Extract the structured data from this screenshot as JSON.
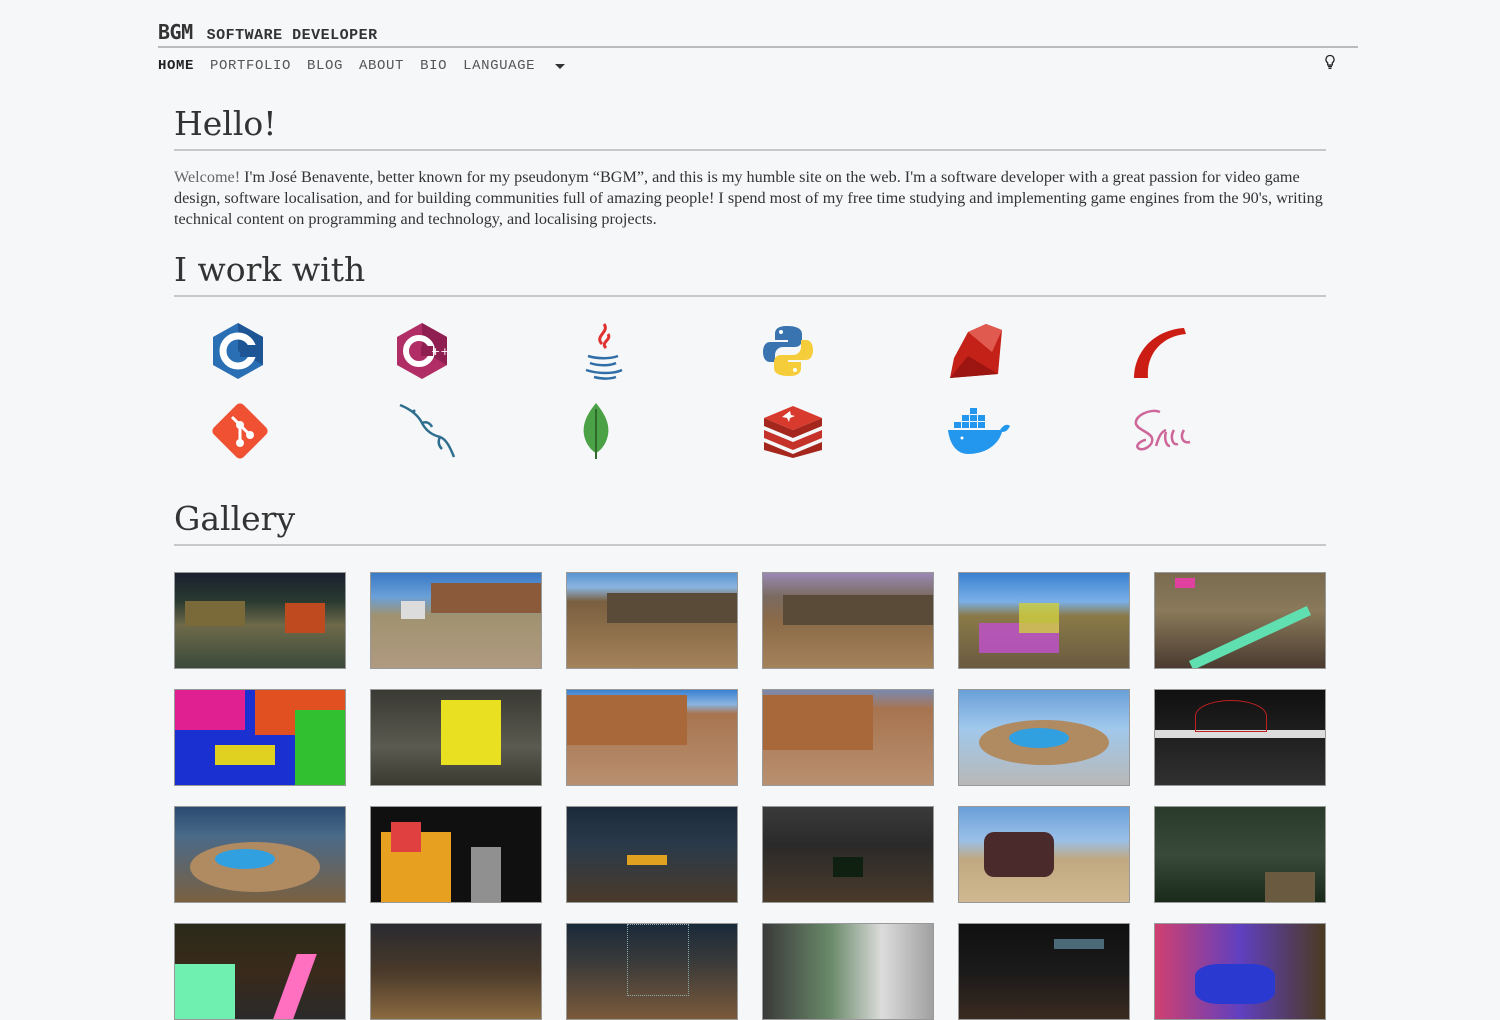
{
  "brand": {
    "name": "BGM",
    "subtitle": "SOFTWARE DEVELOPER"
  },
  "nav": {
    "items": [
      "HOME",
      "PORTFOLIO",
      "BLOG",
      "ABOUT",
      "BIO",
      "LANGUAGE"
    ],
    "active": "HOME",
    "theme_toggle_icon": "lightbulb-icon"
  },
  "intro": {
    "title": "Hello!",
    "welcome": "Welcome!",
    "text": " I'm José Benavente, better known for my pseudonym “BGM”, and this is my humble site on the web. I'm a software developer with a great passion for video game design, software localisation, and for building communities full of amazing people! I spend most of my free time studying and implementing game engines from the 90's, writing technical content on programming and technology, and localising projects."
  },
  "skills": {
    "title": "I work with",
    "icons": [
      "c-icon",
      "cpp-icon",
      "java-icon",
      "python-icon",
      "ruby-icon",
      "rails-icon",
      "git-icon",
      "mysql-icon",
      "mongodb-icon",
      "redis-icon",
      "docker-icon",
      "sass-icon"
    ]
  },
  "gallery": {
    "title": "Gallery",
    "thumbnails": [
      "game-screenshot-1",
      "game-screenshot-2",
      "game-screenshot-3",
      "game-screenshot-4",
      "game-screenshot-5",
      "game-screenshot-6",
      "game-screenshot-7",
      "game-screenshot-8",
      "game-screenshot-9",
      "game-screenshot-10",
      "game-screenshot-11",
      "game-screenshot-12",
      "game-screenshot-13",
      "game-screenshot-14",
      "game-screenshot-15",
      "game-screenshot-16",
      "game-screenshot-17",
      "game-screenshot-18",
      "game-screenshot-19",
      "game-screenshot-20",
      "game-screenshot-21",
      "game-screenshot-22",
      "game-screenshot-23",
      "game-screenshot-24"
    ]
  },
  "colors": {
    "background": "#f6f7f9",
    "text": "#333333",
    "rule": "#c8c8c8"
  }
}
